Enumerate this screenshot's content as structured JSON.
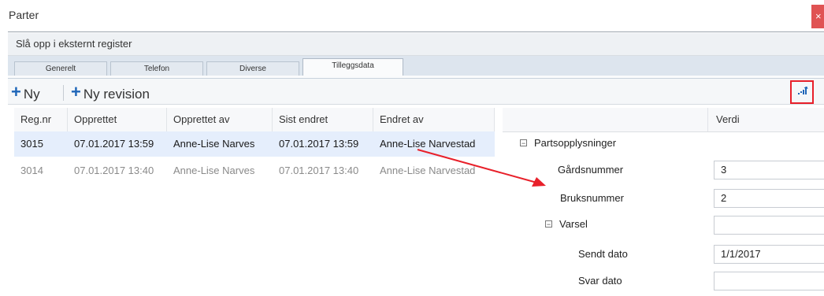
{
  "window": {
    "title": "Parter",
    "close_label": "×"
  },
  "lookup": {
    "label": "Slå opp i eksternt register"
  },
  "tabs": [
    {
      "label": "Generelt",
      "active": false
    },
    {
      "label": "Telefon",
      "active": false
    },
    {
      "label": "Diverse",
      "active": false
    },
    {
      "label": "Tilleggsdata",
      "active": true
    }
  ],
  "toolbar": {
    "new_label": "Ny",
    "new_revision_label": "Ny revision",
    "expand_icon": "expand-columns-icon"
  },
  "grid": {
    "columns": [
      "Reg.nr",
      "Opprettet",
      "Opprettet av",
      "Sist endret",
      "Endret av"
    ],
    "rows": [
      [
        "3015",
        "07.01.2017 13:59",
        "Anne-Lise Narves",
        "07.01.2017 13:59",
        "Anne-Lise Narvestad"
      ],
      [
        "3014",
        "07.01.2017 13:40",
        "Anne-Lise Narves",
        "07.01.2017 13:40",
        "Anne-Lise Narvestad"
      ]
    ]
  },
  "properties": {
    "value_header": "Verdi",
    "group": "Partsopplysninger",
    "gardsnummer": {
      "label": "Gårdsnummer",
      "value": "3"
    },
    "bruksnummer": {
      "label": "Bruksnummer",
      "value": "2"
    },
    "varsel": {
      "label": "Varsel",
      "value": ""
    },
    "sendt_dato": {
      "label": "Sendt dato",
      "value": "1/1/2017"
    },
    "svar_dato": {
      "label": "Svar dato",
      "value": ""
    }
  },
  "colors": {
    "accent": "#1f66b8",
    "annotation": "#e8202a",
    "selection": "#e5eefc"
  }
}
